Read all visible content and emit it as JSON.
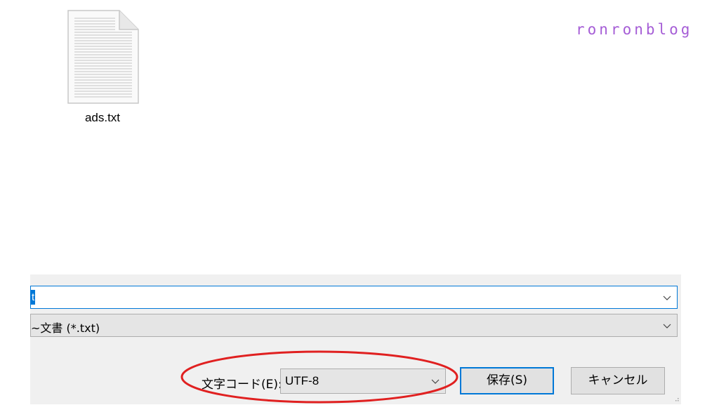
{
  "file": {
    "name": "ads.txt",
    "icon": "text-document-icon"
  },
  "watermark": "ronronblog",
  "dialog": {
    "filename_value": "t",
    "filetype_value": "~文書 (*.txt)",
    "encoding_label": "文字コード(E):",
    "encoding_value": "UTF-8",
    "save_label": "保存(S)",
    "cancel_label": "キャンセル"
  },
  "colors": {
    "accent": "#0078d7",
    "watermark": "#a55dd6",
    "annotation": "#e02020",
    "dialog_bg": "#f0f0f0"
  }
}
